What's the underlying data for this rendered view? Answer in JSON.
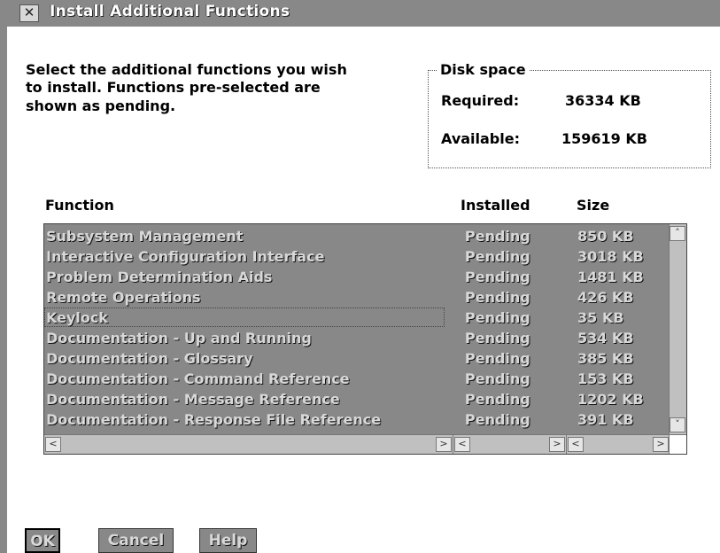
{
  "window": {
    "title": "Install Additional Functions",
    "system_menu_glyph": "✕"
  },
  "instructions": "Select the additional functions you wish\nto install.  Functions pre-selected are\nshown as pending.",
  "disk_space": {
    "legend": "Disk space",
    "required_label": "Required:",
    "required_value": "36334 KB",
    "available_label": "Available:",
    "available_value": "159619 KB"
  },
  "table": {
    "headers": {
      "function": "Function",
      "installed": "Installed",
      "size": "Size"
    },
    "rows": [
      {
        "function": "Subsystem Management",
        "installed": "Pending",
        "size": "850 KB"
      },
      {
        "function": "Interactive Configuration Interface",
        "installed": "Pending",
        "size": "3018 KB"
      },
      {
        "function": "Problem Determination Aids",
        "installed": "Pending",
        "size": "1481 KB"
      },
      {
        "function": "Remote Operations",
        "installed": "Pending",
        "size": "426 KB"
      },
      {
        "function": "Keylock",
        "installed": "Pending",
        "size": "35 KB"
      },
      {
        "function": "Documentation - Up and Running",
        "installed": "Pending",
        "size": "534 KB"
      },
      {
        "function": "Documentation - Glossary",
        "installed": "Pending",
        "size": "385 KB"
      },
      {
        "function": "Documentation - Command Reference",
        "installed": "Pending",
        "size": "153 KB"
      },
      {
        "function": "Documentation - Message Reference",
        "installed": "Pending",
        "size": "1202 KB"
      },
      {
        "function": "Documentation - Response File Reference",
        "installed": "Pending",
        "size": "391 KB"
      }
    ],
    "selected_rows": "all",
    "focused_row": 4
  },
  "scroll_glyphs": {
    "up": "˄",
    "down": "˅",
    "left": "<",
    "right": ">"
  },
  "buttons": {
    "ok": "OK",
    "cancel": "Cancel",
    "help": "Help"
  },
  "colors": {
    "selection_fill": "#a8a8a8",
    "selected_text": "#d8d8d8",
    "window_bg": "#ffffff"
  }
}
